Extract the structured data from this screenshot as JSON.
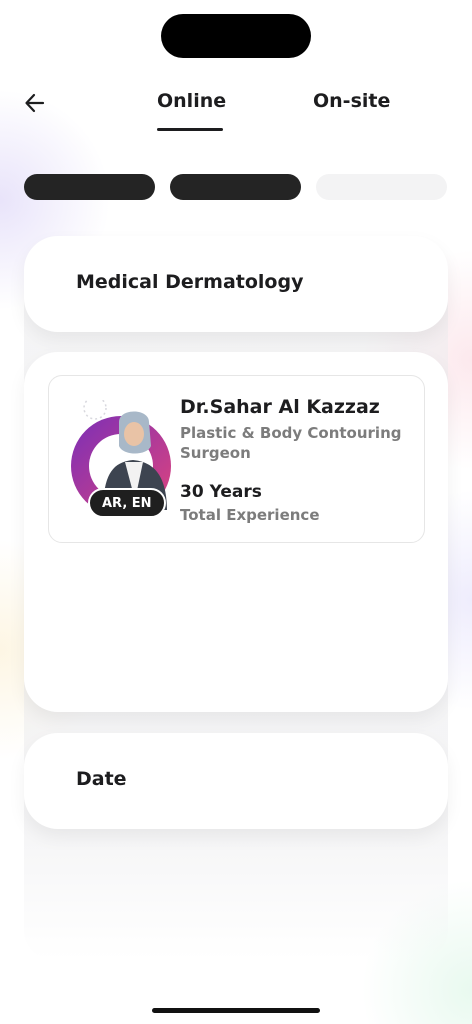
{
  "nav": {
    "back_icon": "arrow-left-icon",
    "tabs": [
      {
        "label": "Online",
        "active": true
      },
      {
        "label": "On-site",
        "active": false
      }
    ]
  },
  "progress": {
    "total_steps": 3,
    "completed_steps": 2,
    "active_color": "#242424",
    "inactive_color": "#f3f3f4"
  },
  "specialty": {
    "label": "Medical Dermatology"
  },
  "doctor": {
    "name": "Dr.Sahar Al Kazzaz",
    "specialty": "Plastic & Body Contouring Surgeon",
    "languages": "AR, EN",
    "experience_value": "30 Years",
    "experience_label": "Total Experience",
    "ring_colors": [
      "#e0447c",
      "#7a2fb7"
    ]
  },
  "date": {
    "label": "Date"
  },
  "colors": {
    "text": "#1d1d1f",
    "muted": "#7c7c7c",
    "badge": "#1f1f1f"
  }
}
